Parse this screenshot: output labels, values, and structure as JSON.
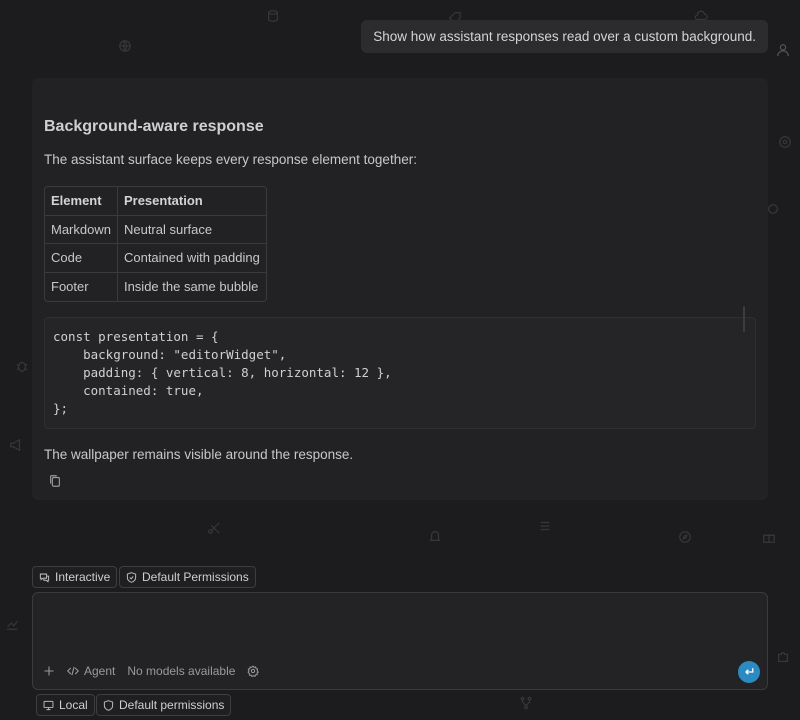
{
  "conversation": {
    "user_message": "Show how assistant responses read over a custom background.",
    "assistant": {
      "title": "Background-aware response",
      "intro": "The assistant surface keeps every response element together:",
      "table": {
        "headers": [
          "Element",
          "Presentation"
        ],
        "rows": [
          [
            "Markdown",
            "Neutral surface"
          ],
          [
            "Code",
            "Contained with padding"
          ],
          [
            "Footer",
            "Inside the same bubble"
          ]
        ]
      },
      "code_lines": [
        "const presentation = {",
        "    background: \"editorWidget\",",
        "    padding: { vertical: 8, horizontal: 12 },",
        "    contained: true,",
        "};"
      ],
      "footer_text": "The wallpaper remains visible around the response.",
      "copy_icon": "copy-icon"
    }
  },
  "chips": {
    "interactive": "Interactive",
    "default_permissions": "Default Permissions"
  },
  "composer": {
    "placeholder": "",
    "add_icon": "plus-icon",
    "mode": "Agent",
    "models": "No models available",
    "settings_icon": "gear-icon",
    "send_icon": "return-icon"
  },
  "bottom_bar": {
    "location": "Local",
    "permissions": "Default permissions"
  },
  "colors": {
    "background": "#1c1c1e",
    "bubble": "#222224",
    "accent": "#2b8ac2"
  }
}
